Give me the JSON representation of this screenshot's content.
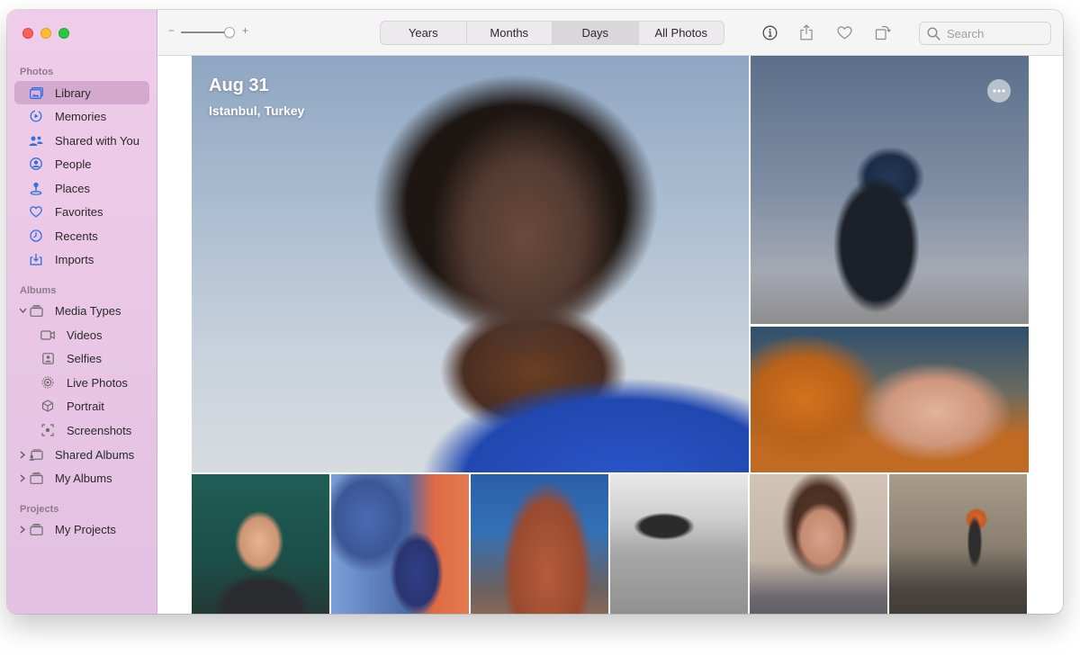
{
  "window": {
    "traffic_lights": [
      "close",
      "minimize",
      "maximize"
    ]
  },
  "sidebar": {
    "sections": {
      "photos": "Photos",
      "albums": "Albums",
      "projects": "Projects"
    },
    "photos_items": [
      {
        "label": "Library",
        "icon": "library-icon",
        "selected": true
      },
      {
        "label": "Memories",
        "icon": "memories-icon"
      },
      {
        "label": "Shared with You",
        "icon": "shared-with-you-icon"
      },
      {
        "label": "People",
        "icon": "people-icon"
      },
      {
        "label": "Places",
        "icon": "places-icon"
      },
      {
        "label": "Favorites",
        "icon": "heart-icon"
      },
      {
        "label": "Recents",
        "icon": "clock-icon"
      },
      {
        "label": "Imports",
        "icon": "import-icon"
      }
    ],
    "album_items": [
      {
        "label": "Media Types",
        "icon": "album-stack-icon",
        "disclosure": "expanded"
      },
      {
        "label": "Videos",
        "icon": "video-icon"
      },
      {
        "label": "Selfies",
        "icon": "selfie-icon"
      },
      {
        "label": "Live Photos",
        "icon": "live-photo-icon"
      },
      {
        "label": "Portrait",
        "icon": "portrait-cube-icon"
      },
      {
        "label": "Screenshots",
        "icon": "screenshot-icon"
      },
      {
        "label": "Shared Albums",
        "icon": "shared-album-icon",
        "disclosure": "collapsed"
      },
      {
        "label": "My Albums",
        "icon": "album-stack-icon",
        "disclosure": "collapsed"
      }
    ],
    "project_items": [
      {
        "label": "My Projects",
        "icon": "album-stack-icon",
        "disclosure": "collapsed"
      }
    ],
    "accent_color": "#2f6fe0"
  },
  "toolbar": {
    "zoom": {
      "minus": "−",
      "plus": "+",
      "value": 0.9
    },
    "view_tabs": [
      "Years",
      "Months",
      "Days",
      "All Photos"
    ],
    "active_tab": "Days",
    "icons": [
      "info-icon",
      "share-icon",
      "heart-icon",
      "rotate-icon"
    ],
    "search_placeholder": "Search"
  },
  "content": {
    "date": "Aug 31",
    "location": "Istanbul, Turkey"
  }
}
